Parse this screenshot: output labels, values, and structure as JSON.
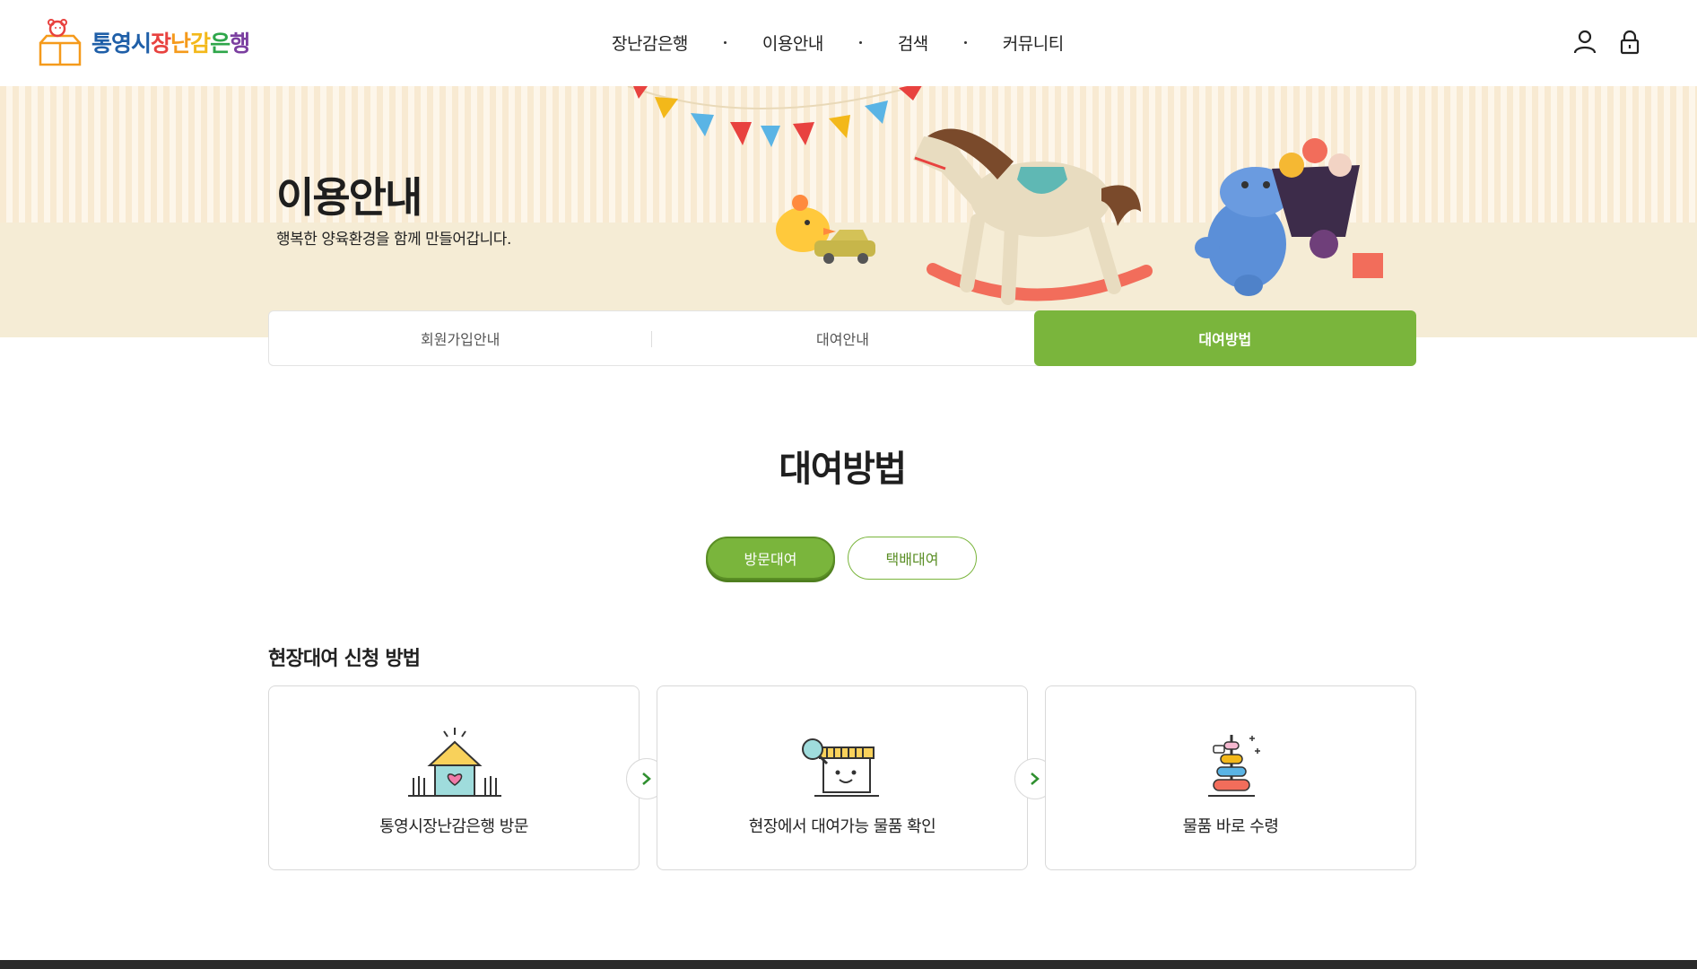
{
  "header": {
    "logo": {
      "parts": [
        {
          "text": "통영시",
          "color": "#1f5fa8"
        },
        {
          "text": "장",
          "color": "#e8423f"
        },
        {
          "text": "난",
          "color": "#f59a1b"
        },
        {
          "text": "감",
          "color": "#f3b81a"
        },
        {
          "text": "은",
          "color": "#2ea64a"
        },
        {
          "text": "행",
          "color": "#7b3fa0"
        }
      ]
    },
    "nav": [
      {
        "label": "장난감은행"
      },
      {
        "label": "이용안내"
      },
      {
        "label": "검색"
      },
      {
        "label": "커뮤니티"
      }
    ],
    "icons": [
      "user-icon",
      "lock-icon"
    ]
  },
  "banner": {
    "title": "이용안내",
    "subtitle": "행복한 양육환경을 함께 만들어갑니다."
  },
  "tabs": [
    {
      "label": "회원가입안내",
      "active": false
    },
    {
      "label": "대여안내",
      "active": false
    },
    {
      "label": "대여방법",
      "active": true
    }
  ],
  "section": {
    "title": "대여방법",
    "toggles": [
      {
        "label": "방문대여",
        "active": true
      },
      {
        "label": "택배대여",
        "active": false
      }
    ],
    "subtitle": "현장대여 신청 방법",
    "steps": [
      {
        "label": "통영시장난감은행 방문",
        "icon": "house-icon"
      },
      {
        "label": "현장에서 대여가능 물품 확인",
        "icon": "store-search-icon"
      },
      {
        "label": "물품 바로 수령",
        "icon": "ring-stacker-icon"
      }
    ]
  },
  "colors": {
    "accent": "#7ab53c",
    "accent_dark": "#5a8e25",
    "footer": "#2b2b2b"
  }
}
